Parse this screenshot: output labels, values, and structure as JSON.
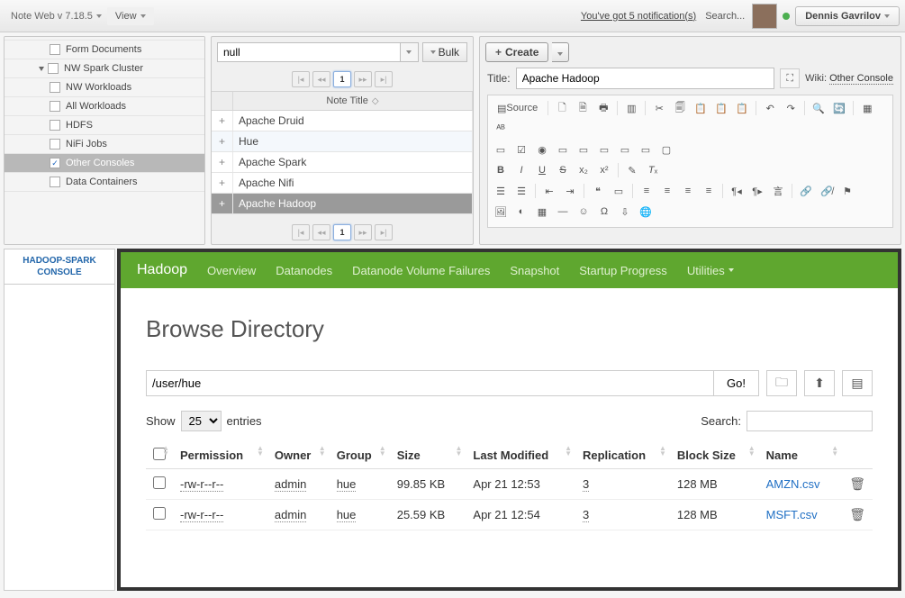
{
  "app": {
    "title": "Note Web v 7.18.5",
    "view_label": "View"
  },
  "topbar": {
    "notifications": "You've got 5 notification(s)",
    "search": "Search...",
    "user": "Dennis Gavrilov"
  },
  "tree": {
    "items": [
      {
        "label": "Form Documents",
        "checked": false,
        "level": "l1"
      },
      {
        "label": "NW Spark Cluster",
        "checked": false,
        "level": "group",
        "expandable": true
      },
      {
        "label": "NW Workloads",
        "checked": false,
        "level": "l1"
      },
      {
        "label": "All Workloads",
        "checked": false,
        "level": "l1"
      },
      {
        "label": "HDFS",
        "checked": false,
        "level": "l1"
      },
      {
        "label": "NiFi Jobs",
        "checked": false,
        "level": "l1"
      },
      {
        "label": "Other Consoles",
        "checked": true,
        "level": "l1",
        "selected": true
      },
      {
        "label": "Data Containers",
        "checked": false,
        "level": "l1"
      }
    ]
  },
  "center": {
    "combo_value": "null",
    "bulk_label": "Bulk",
    "page": "1",
    "header": "Note Title",
    "rows": [
      {
        "title": "Apache Druid"
      },
      {
        "title": "Hue",
        "alt": true
      },
      {
        "title": "Apache Spark"
      },
      {
        "title": "Apache Nifi"
      },
      {
        "title": "Apache Hadoop",
        "selected": true
      }
    ]
  },
  "right": {
    "create_label": "Create",
    "title_label": "Title:",
    "title_value": "Apache Hadoop",
    "wiki_prefix": "Wiki:",
    "wiki_link": "Other Console",
    "source_label": "Source"
  },
  "console": {
    "tab_label": "HADOOP-SPARK CONSOLE",
    "brand": "Hadoop",
    "nav": [
      "Overview",
      "Datanodes",
      "Datanode Volume Failures",
      "Snapshot",
      "Startup Progress"
    ],
    "utilities": "Utilities",
    "heading": "Browse Directory",
    "path": "/user/hue",
    "go": "Go!",
    "show": "Show",
    "entries_count": "25",
    "entries_suffix": "entries",
    "search_label": "Search:",
    "cols": [
      "Permission",
      "Owner",
      "Group",
      "Size",
      "Last Modified",
      "Replication",
      "Block Size",
      "Name"
    ],
    "rows": [
      {
        "perm": "-rw-r--r--",
        "owner": "admin",
        "group": "hue",
        "size": "99.85 KB",
        "mod": "Apr 21 12:53",
        "rep": "3",
        "block": "128 MB",
        "name": "AMZN.csv"
      },
      {
        "perm": "-rw-r--r--",
        "owner": "admin",
        "group": "hue",
        "size": "25.59 KB",
        "mod": "Apr 21 12:54",
        "rep": "3",
        "block": "128 MB",
        "name": "MSFT.csv"
      }
    ]
  }
}
